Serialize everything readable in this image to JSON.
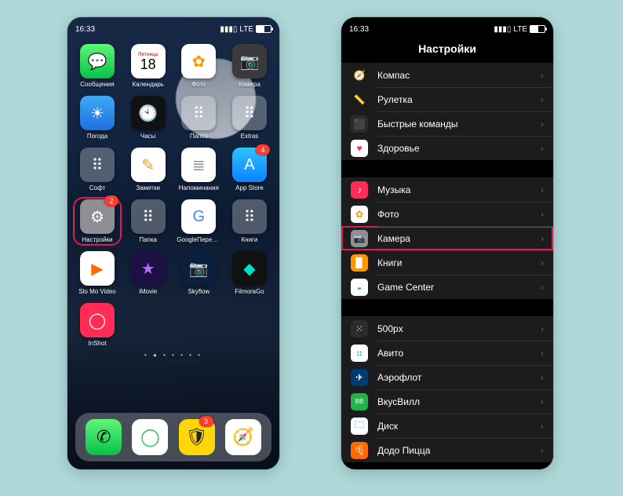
{
  "status": {
    "time": "16:33",
    "net": "LTE"
  },
  "home": {
    "apps": [
      {
        "label": "Сообщения",
        "bg": "linear-gradient(#5ff777,#07c148)",
        "glyph": "💬"
      },
      {
        "label": "Календарь",
        "bg": "#ffffff",
        "glyph": "18",
        "fg": "#e53935",
        "top": "Пятница"
      },
      {
        "label": "Фото",
        "bg": "#ffffff",
        "glyph": "✿",
        "fg": "#ff9500"
      },
      {
        "label": "Камера",
        "bg": "#3a3a3c",
        "glyph": "📷"
      },
      {
        "label": "Погода",
        "bg": "linear-gradient(#3fa9f5,#1f6fe0)",
        "glyph": "☀"
      },
      {
        "label": "Часы",
        "bg": "#111111",
        "glyph": "🕙"
      },
      {
        "label": "Папка",
        "bg": "rgba(255,255,255,.28)",
        "glyph": "⠿",
        "fg": "#fff"
      },
      {
        "label": "Extras",
        "bg": "rgba(255,255,255,.28)",
        "glyph": "⠿",
        "fg": "#fff"
      },
      {
        "label": "Софт",
        "bg": "rgba(255,255,255,.28)",
        "glyph": "⠿",
        "fg": "#fff"
      },
      {
        "label": "Заметки",
        "bg": "#fff",
        "glyph": "✎",
        "fg": "#f0a30a"
      },
      {
        "label": "Напоминания",
        "bg": "#fff",
        "glyph": "≣",
        "fg": "#8e8e93"
      },
      {
        "label": "App Store",
        "bg": "linear-gradient(#2fc1ff,#0a84ff)",
        "glyph": "A",
        "badge": "4"
      },
      {
        "label": "Настройки",
        "bg": "#8e8e93",
        "glyph": "⚙",
        "highlight": true,
        "badge": "2"
      },
      {
        "label": "Папка",
        "bg": "rgba(255,255,255,.28)",
        "glyph": "⠿",
        "fg": "#fff"
      },
      {
        "label": "GoogleПерев…",
        "bg": "#ffffff",
        "glyph": "G",
        "fg": "#4285f4"
      },
      {
        "label": "Книги",
        "bg": "rgba(255,255,255,.28)",
        "glyph": "⠿",
        "fg": "#fff"
      },
      {
        "label": "Slo Mo Video",
        "bg": "#ffffff",
        "glyph": "▶",
        "fg": "#ff6a00"
      },
      {
        "label": "iMovie",
        "bg": "#1d1044",
        "glyph": "★",
        "fg": "#b06dff"
      },
      {
        "label": "Skyflow",
        "bg": "#0a1e3d",
        "glyph": "📷",
        "fg": "#67b7ff"
      },
      {
        "label": "FilmoraGo",
        "bg": "#111",
        "glyph": "◆",
        "fg": "#00e3c0"
      },
      {
        "label": "InShot",
        "bg": "#ff2d55",
        "glyph": "◯"
      }
    ],
    "dock": [
      {
        "name": "phone",
        "bg": "linear-gradient(#5ff777,#07c148)",
        "glyph": "✆"
      },
      {
        "name": "circle",
        "bg": "#ffffff",
        "glyph": "◯",
        "fg": "#20c04e"
      },
      {
        "name": "tinkoff",
        "bg": "#ffd60a",
        "glyph": "🛡",
        "fg": "#222",
        "badge": "3"
      },
      {
        "name": "safari",
        "bg": "#ffffff",
        "glyph": "🧭",
        "fg": "#0a84ff"
      }
    ]
  },
  "settings": {
    "title": "Настройки",
    "groups": [
      [
        {
          "label": "Компас",
          "bg": "#1c1c1e",
          "glyph": "🧭"
        },
        {
          "label": "Рулетка",
          "bg": "#1c1c1e",
          "glyph": "📏"
        },
        {
          "label": "Быстрые команды",
          "bg": "#1c1c1e",
          "glyph": "⬛",
          "ibg": "#2c2c2e"
        },
        {
          "label": "Здоровье",
          "bg": "#ffffff",
          "glyph": "♥",
          "fg": "#ff2d55"
        }
      ],
      [
        {
          "label": "Музыка",
          "bg": "#ff2d55",
          "glyph": "♪"
        },
        {
          "label": "Фото",
          "bg": "#ffffff",
          "glyph": "✿",
          "fg": "#ff9500"
        },
        {
          "label": "Камера",
          "bg": "#8e8e93",
          "glyph": "📷",
          "highlight": true
        },
        {
          "label": "Книги",
          "bg": "#ff9500",
          "glyph": "▉"
        },
        {
          "label": "Game Center",
          "bg": "#ffffff",
          "glyph": "◒",
          "fg": "#34c759"
        }
      ],
      [
        {
          "label": "500px",
          "bg": "#2c2c2e",
          "glyph": "⁙"
        },
        {
          "label": "Авито",
          "bg": "#ffffff",
          "glyph": "⠶",
          "fg": "#00aaff"
        },
        {
          "label": "Аэрофлот",
          "bg": "#003a70",
          "glyph": "✈"
        },
        {
          "label": "ВкусВилл",
          "bg": "#24b24c",
          "glyph": "BB",
          "fs": "8px"
        },
        {
          "label": "Диск",
          "bg": "#ffffff",
          "glyph": "🗀",
          "fg": "#0a84ff"
        },
        {
          "label": "Додо Пицца",
          "bg": "#ff6a00",
          "glyph": "🍕"
        }
      ]
    ]
  }
}
